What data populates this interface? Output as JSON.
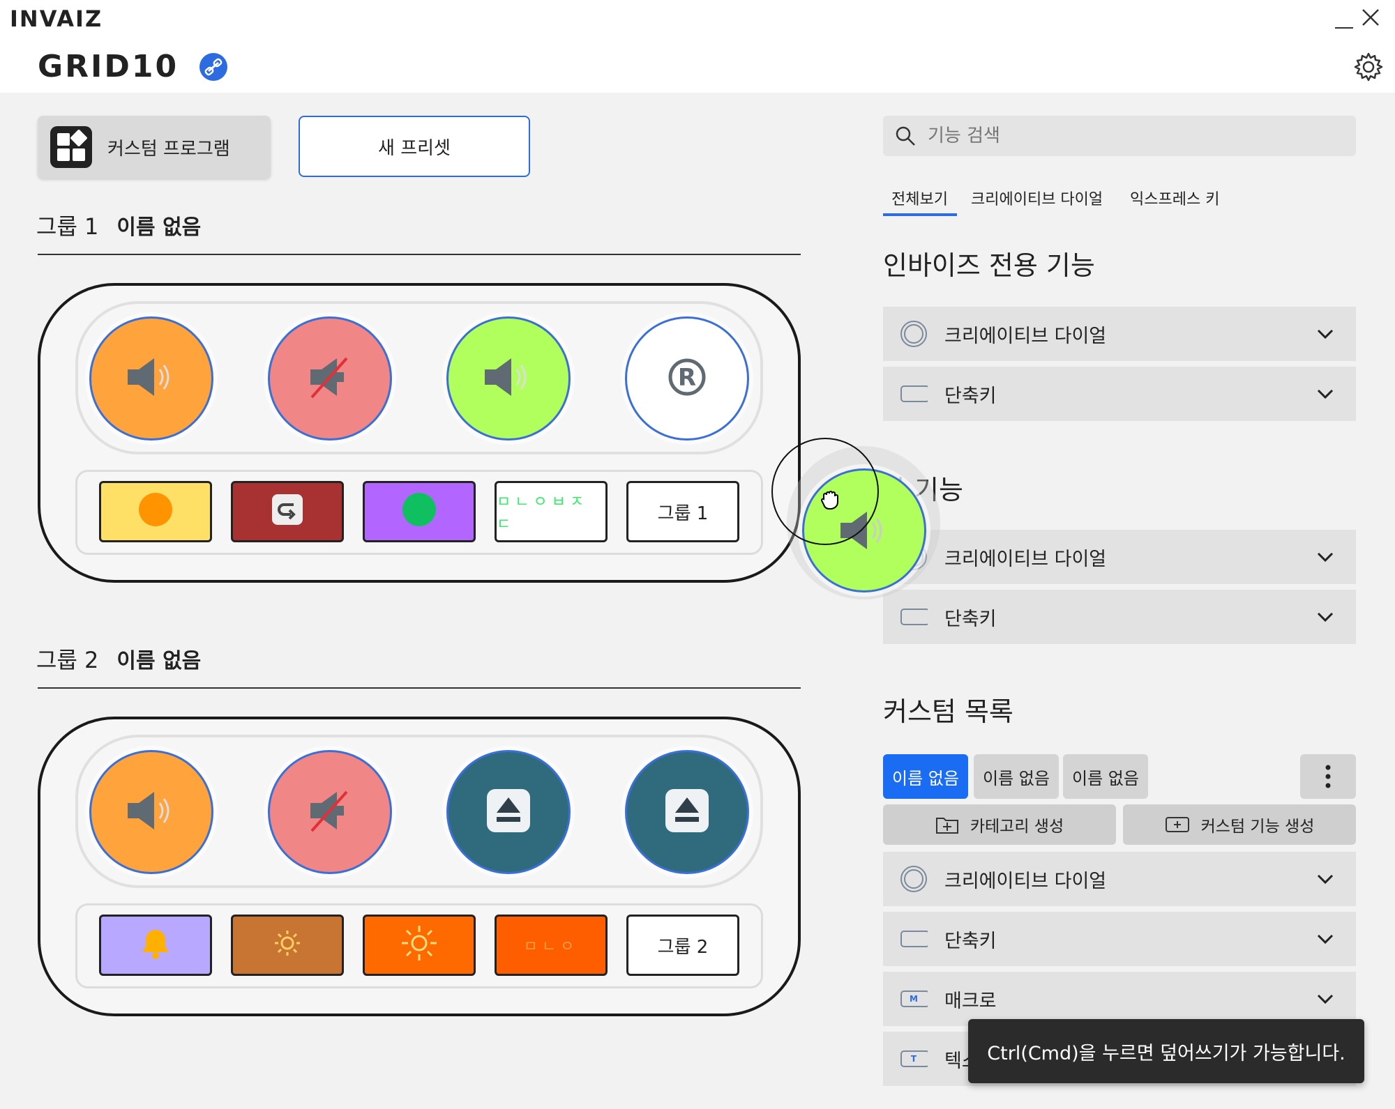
{
  "app": {
    "brand": "INVAIZ",
    "product": "GRID10"
  },
  "left": {
    "custom_program_label": "커스텀 프로그램",
    "new_preset_label": "새 프리셋",
    "groups": [
      {
        "label": "그룹 1",
        "name": "이름 없음",
        "knobs": [
          {
            "color": "#ffa43d",
            "icon": "volume-up-icon"
          },
          {
            "color": "#f08686",
            "icon": "mute-icon"
          },
          {
            "color": "#b1ff5c",
            "icon": "volume-up-icon"
          },
          {
            "color": "#ffffff",
            "icon": "registered-icon",
            "glyph": "®"
          }
        ],
        "pads": [
          {
            "color": "#ffe066",
            "icon": "orange-dot-icon"
          },
          {
            "color": "#a83232",
            "icon": "undo-icon"
          },
          {
            "color": "#b266ff",
            "icon": "green-dot-icon"
          },
          {
            "color": "#ffffff",
            "icon": "korean-text-icon",
            "text": "ㅁㄴㅇㅂㅈㄷ"
          },
          {
            "color": "#ffffff",
            "text": "그룹 1"
          }
        ]
      },
      {
        "label": "그룹 2",
        "name": "이름 없음",
        "knobs": [
          {
            "color": "#ffa43d",
            "icon": "volume-up-icon"
          },
          {
            "color": "#f08686",
            "icon": "mute-icon"
          },
          {
            "color": "#2f6b7d",
            "icon": "eject-icon"
          },
          {
            "color": "#2f6b7d",
            "icon": "eject-icon"
          }
        ],
        "pads": [
          {
            "color": "#b8a8ff",
            "icon": "bell-icon"
          },
          {
            "color": "#c87533",
            "icon": "brightness-low-icon"
          },
          {
            "color": "#ff6a00",
            "icon": "brightness-high-icon"
          },
          {
            "color": "#ff5e00",
            "icon": "korean-text-icon",
            "text": "ㅁㄴㅇ"
          },
          {
            "color": "#ffffff",
            "text": "그룹 2"
          }
        ]
      }
    ]
  },
  "right": {
    "search_placeholder": "기능 검색",
    "tabs": [
      "전체보기",
      "크리에이티브 다이얼",
      "익스프레스 키"
    ],
    "section_invaiz": "인바이즈 전용 기능",
    "section_general": "일반 기능",
    "section_general_visible": "반 기능",
    "section_custom": "커스텀 목록",
    "invaiz_rows": [
      {
        "label": "크리에이티브 다이얼",
        "icon": "dial-icon"
      },
      {
        "label": "단축키",
        "icon": "keyboard-key-icon"
      }
    ],
    "general_rows": [
      {
        "label": "크리에이티브 다이얼",
        "icon": "dial-icon"
      },
      {
        "label": "단축키",
        "icon": "keyboard-key-icon"
      }
    ],
    "custom_chips": [
      "이름 없음",
      "이름 없음",
      "이름 없음"
    ],
    "create_category_label": "카테고리 생성",
    "create_custom_label": "커스텀 기능 생성",
    "custom_rows": [
      {
        "label": "크리에이티브 다이얼",
        "icon": "dial-icon"
      },
      {
        "label": "단축키",
        "icon": "keyboard-key-icon"
      },
      {
        "label": "매크로",
        "icon": "macro-icon",
        "badge": "M"
      },
      {
        "label": "텍스",
        "icon": "text-icon",
        "badge": "T"
      }
    ]
  },
  "toast": "Ctrl(Cmd)을 누르면 덮어쓰기가 가능합니다.",
  "colors": {
    "accent": "#2d6be0",
    "drag_knob": "#b1ff5c"
  }
}
